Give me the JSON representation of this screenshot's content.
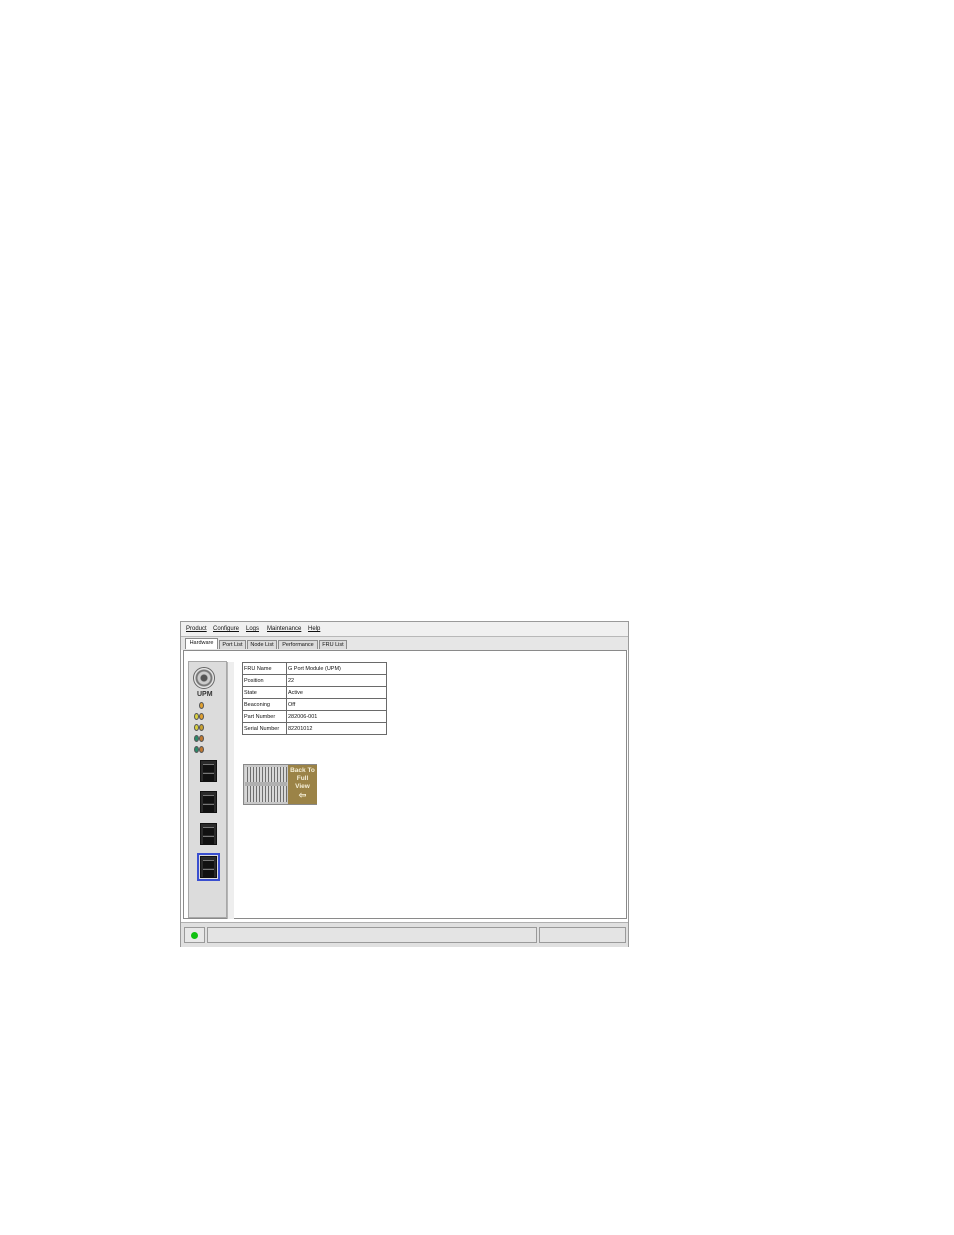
{
  "menu": [
    "Product",
    "Configure",
    "Logs",
    "Maintenance",
    "Help"
  ],
  "tabs": [
    {
      "label": "Hardware",
      "active": true
    },
    {
      "label": "Port List",
      "active": false
    },
    {
      "label": "Node List",
      "active": false
    },
    {
      "label": "Performance",
      "active": false
    },
    {
      "label": "FRU List",
      "active": false
    }
  ],
  "module": {
    "label": "UPM",
    "leds": [
      "#e0a030",
      "#d8d040",
      "#c8a030",
      "#2a8a6a",
      "#c07830"
    ],
    "ports": 4,
    "selected_port": 4
  },
  "fru_info": {
    "rows": [
      {
        "key": "FRU Name",
        "value": "G Port Module (UPM)"
      },
      {
        "key": "Position",
        "value": "22"
      },
      {
        "key": "State",
        "value": "Active"
      },
      {
        "key": "Beaconing",
        "value": "Off"
      },
      {
        "key": "Part Number",
        "value": "282006-001"
      },
      {
        "key": "Serial Number",
        "value": "82201012"
      }
    ]
  },
  "back_button": {
    "line1": "Back To",
    "line2": "Full",
    "line3": "View",
    "icon": "arrow-left-icon"
  },
  "status": {
    "indicator_color": "#10c010"
  }
}
